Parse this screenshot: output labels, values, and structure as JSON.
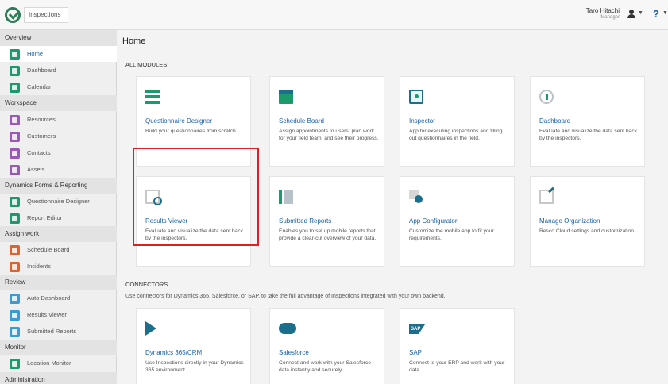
{
  "app": {
    "title": "Inspections"
  },
  "user": {
    "name": "Taro Hitachi",
    "role": "Manager"
  },
  "help": {
    "label": "?"
  },
  "sidebar": {
    "sections": [
      {
        "label": "Overview"
      },
      {
        "label": "Workspace"
      },
      {
        "label": "Dynamics Forms & Reporting"
      },
      {
        "label": "Assign work"
      },
      {
        "label": "Review"
      },
      {
        "label": "Monitor"
      },
      {
        "label": "Administration"
      }
    ],
    "items": [
      {
        "label": "Home",
        "color": "#1b9b6b"
      },
      {
        "label": "Dashboard",
        "color": "#1b9b6b"
      },
      {
        "label": "Calendar",
        "color": "#1b9b6b"
      },
      {
        "label": "Resources",
        "color": "#9b59b6"
      },
      {
        "label": "Customers",
        "color": "#9b59b6"
      },
      {
        "label": "Contacts",
        "color": "#9b59b6"
      },
      {
        "label": "Assets",
        "color": "#9b59b6"
      },
      {
        "label": "Questionnaire Designer",
        "color": "#1b9b6b"
      },
      {
        "label": "Report Editor",
        "color": "#1b9b6b"
      },
      {
        "label": "Schedule Board",
        "color": "#e0642a"
      },
      {
        "label": "Incidents",
        "color": "#e0642a"
      },
      {
        "label": "Auto Dashboard",
        "color": "#3a9bd5"
      },
      {
        "label": "Results Viewer",
        "color": "#3a9bd5"
      },
      {
        "label": "Submitted Reports",
        "color": "#3a9bd5"
      },
      {
        "label": "Location Monitor",
        "color": "#1b9b6b"
      }
    ]
  },
  "main": {
    "title": "Home",
    "modules_label": "ALL MODULES",
    "modules": [
      {
        "title": "Questionnaire Designer",
        "desc": "Build your questionnaires from scratch.",
        "icon": "questionnaire-icon"
      },
      {
        "title": "Schedule Board",
        "desc": "Assign appointments to users, plan work for your field team, and see their progress.",
        "icon": "schedule-icon"
      },
      {
        "title": "Inspector",
        "desc": "App for executing inspections and filling out questionnaires in the field.",
        "icon": "inspector-icon"
      },
      {
        "title": "Dashboard",
        "desc": "Evaluate and visualize the data sent back by the inspectors.",
        "icon": "dashboard-icon"
      },
      {
        "title": "Results Viewer",
        "desc": "Evaluate and visualize the data sent back by the inspectors.",
        "icon": "results-icon"
      },
      {
        "title": "Submitted Reports",
        "desc": "Enables you to set up mobile reports that provide a clear-cut overview of your data.",
        "icon": "reports-icon"
      },
      {
        "title": "App Configurator",
        "desc": "Customize the mobile app to fit your requirements.",
        "icon": "gear-icon"
      },
      {
        "title": "Manage Organization",
        "desc": "Resco Cloud settings and customization.",
        "icon": "organization-icon"
      }
    ],
    "connectors_label": "CONNECTORS",
    "connectors_desc": "Use connectors for Dynamics 365, Salesforce, or SAP, to take the full advantage of Inspections integrated with your own backend.",
    "connectors": [
      {
        "title": "Dynamics 365/CRM",
        "desc": "Use Inspections directly in your Dynamics 365 environment",
        "icon": "dynamics-icon"
      },
      {
        "title": "Salesforce",
        "desc": "Connect and work with your Salesforce data instantly and securely.",
        "icon": "salesforce-icon"
      },
      {
        "title": "SAP",
        "desc": "Connect to your ERP and work with your data.",
        "icon": "sap-icon",
        "logo_text": "SAP"
      }
    ]
  }
}
